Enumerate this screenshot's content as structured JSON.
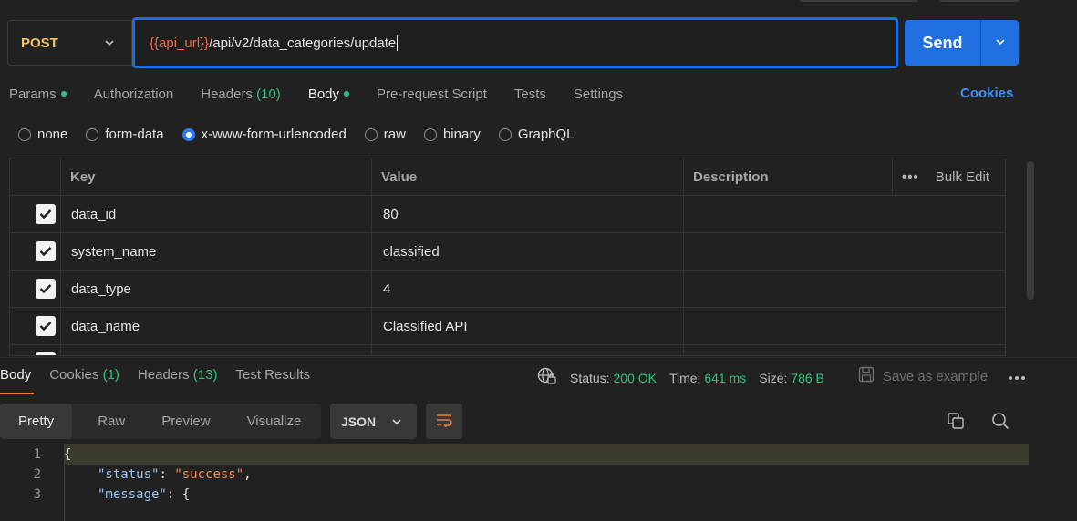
{
  "request": {
    "method": "POST",
    "url_variable": "{{api_url}}",
    "url_path": "/api/v2/data_categories/update",
    "send_label": "Send"
  },
  "request_tabs": [
    {
      "label": "Params",
      "dot": true,
      "count": ""
    },
    {
      "label": "Authorization",
      "dot": false,
      "count": ""
    },
    {
      "label": "Headers",
      "dot": false,
      "count": "(10)"
    },
    {
      "label": "Body",
      "dot": true,
      "count": "",
      "active": true
    },
    {
      "label": "Pre-request Script",
      "dot": false,
      "count": ""
    },
    {
      "label": "Tests",
      "dot": false,
      "count": ""
    },
    {
      "label": "Settings",
      "dot": false,
      "count": ""
    }
  ],
  "cookies_link": "Cookies",
  "body_types": [
    {
      "label": "none",
      "selected": false
    },
    {
      "label": "form-data",
      "selected": false
    },
    {
      "label": "x-www-form-urlencoded",
      "selected": true
    },
    {
      "label": "raw",
      "selected": false
    },
    {
      "label": "binary",
      "selected": false
    },
    {
      "label": "GraphQL",
      "selected": false
    }
  ],
  "table": {
    "headers": {
      "key": "Key",
      "value": "Value",
      "description": "Description",
      "bulk_edit": "Bulk Edit"
    },
    "rows": [
      {
        "checked": true,
        "key": "data_id",
        "value": "80",
        "description": ""
      },
      {
        "checked": true,
        "key": "system_name",
        "value": "classified",
        "description": ""
      },
      {
        "checked": true,
        "key": "data_type",
        "value": "4",
        "description": ""
      },
      {
        "checked": true,
        "key": "data_name",
        "value": "Classified API",
        "description": ""
      }
    ]
  },
  "response_tabs": [
    {
      "label": "Body",
      "count": "",
      "active": true
    },
    {
      "label": "Cookies",
      "count": "(1)"
    },
    {
      "label": "Headers",
      "count": "(13)"
    },
    {
      "label": "Test Results",
      "count": ""
    }
  ],
  "response_status": {
    "status_label": "Status:",
    "status_value": "200 OK",
    "time_label": "Time:",
    "time_value": "641 ms",
    "size_label": "Size:",
    "size_value": "786 B",
    "save_example": "Save as example"
  },
  "view_modes": [
    "Pretty",
    "Raw",
    "Preview",
    "Visualize"
  ],
  "format_selected": "JSON",
  "code_lines": [
    {
      "n": "1",
      "text": "{"
    },
    {
      "n": "2",
      "key": "\"status\"",
      "sep": ": ",
      "value": "\"success\"",
      "tail": ","
    },
    {
      "n": "3",
      "key": "\"message\"",
      "sep": ": ",
      "value": "",
      "tail": "{"
    }
  ],
  "colors": {
    "accent": "#1f6fe0",
    "method": "#f4c36a",
    "variable": "#f1684e",
    "status_ok": "#2ec27e",
    "tab_underline": "#f07d3c"
  }
}
